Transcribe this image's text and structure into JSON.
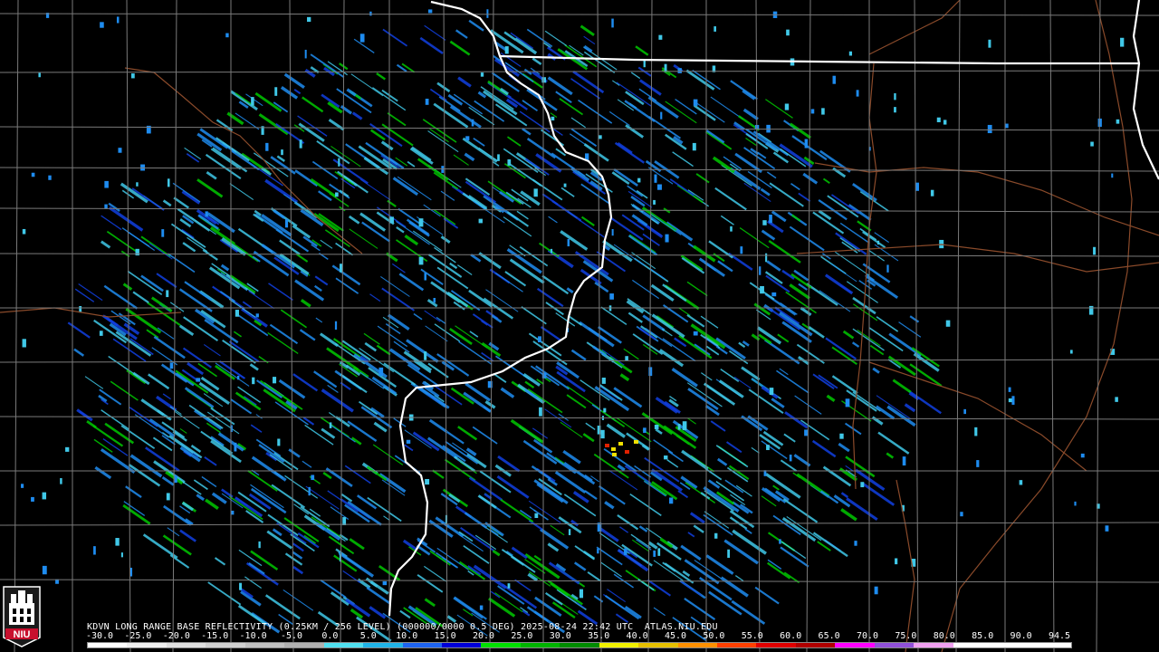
{
  "product": {
    "caption": "KDVN LONG RANGE BASE REFLECTIVITY (0.25KM / 256 LEVEL) (000000/0000 0.5 DEG) 2025-08-24 22:42 UTC  ATLAS.NIU.EDU"
  },
  "logo": {
    "text": "NIU",
    "color": "#c8102e"
  },
  "scale": {
    "labels": [
      "-30.0",
      "-25.0",
      "-20.0",
      "-15.0",
      "-10.0",
      "-5.0",
      "0.0",
      "5.0",
      "10.0",
      "15.0",
      "20.0",
      "25.0",
      "30.0",
      "35.0",
      "40.0",
      "45.0",
      "50.0",
      "55.0",
      "60.0",
      "65.0",
      "70.0",
      "75.0",
      "80.0",
      "85.0",
      "90.0",
      "94.5"
    ],
    "colors": [
      "#ffffff",
      "#f0f0f0",
      "#e0e0e0",
      "#d0d0d0",
      "#c0c0c0",
      "#b0b0b0",
      "#50e0f0",
      "#20b4e8",
      "#1e64f0",
      "#0000d8",
      "#00e000",
      "#00b400",
      "#008c00",
      "#f0f000",
      "#e6c000",
      "#ff9000",
      "#ff4000",
      "#e00000",
      "#b00000",
      "#ff00ff",
      "#9050d8",
      "#f0a0f0",
      "#ffffff",
      "#ffffff",
      "#ffffff"
    ]
  },
  "map_colors": {
    "background": "#000000",
    "county": "#7a7a7a",
    "state": "#ffffff",
    "river": "#8a4a2a",
    "light_blue": "#40c8e8",
    "mid_blue": "#1e8cf0",
    "dark_blue": "#1040e0",
    "green": "#00c800",
    "yellow": "#f0e000",
    "red": "#e02000"
  },
  "radar": {
    "site": "KDVN"
  }
}
